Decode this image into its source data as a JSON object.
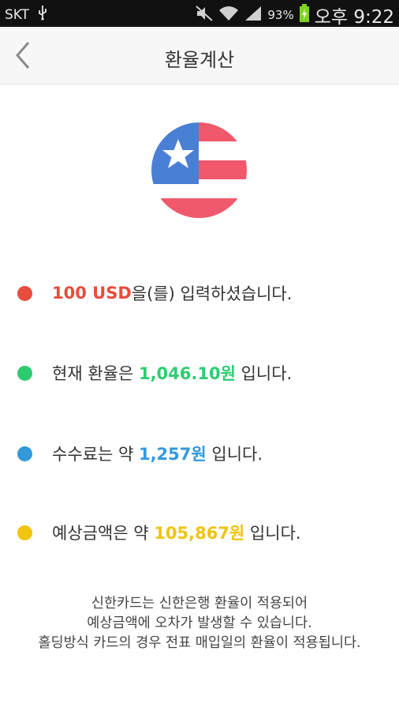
{
  "status_bar": {
    "carrier": "SKT",
    "battery_percent": "93%",
    "time": "오후 9:22"
  },
  "app_bar": {
    "title": "환율계산"
  },
  "flag": {
    "currency": "USD"
  },
  "rows": [
    {
      "highlight": "100 USD",
      "text_after": "을(를) 입력하셨습니다.",
      "color": "#e74c3c"
    },
    {
      "text_before": "현재 환율은 ",
      "highlight": "1,046.10원",
      "text_after": " 입니다.",
      "color": "#2ecc71"
    },
    {
      "text_before": "수수료는 약 ",
      "highlight": "1,257원",
      "text_after": " 입니다.",
      "color": "#3498db"
    },
    {
      "text_before": "예상금액은 약 ",
      "highlight": "105,867원",
      "text_after": " 입니다.",
      "color": "#f1c40f"
    }
  ],
  "notice": {
    "line1": "신한카드는 신한은행 환율이 적용되어",
    "line2": "예상금액에 오차가 발생할 수 있습니다.",
    "line3": "홀딩방식 카드의 경우 전표 매입일의 환율이 적용됩니다."
  },
  "colors": {
    "flag_blue": "#4a7fd6",
    "flag_red": "#f0596b",
    "flag_white": "#ffffff"
  }
}
